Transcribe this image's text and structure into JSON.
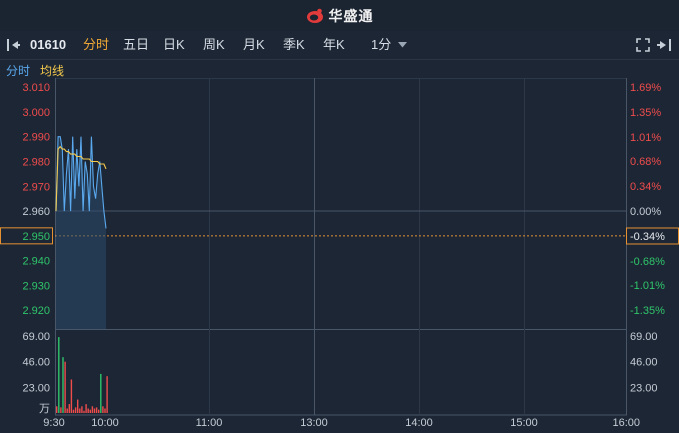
{
  "app": {
    "brand": "华盛通"
  },
  "toolbar": {
    "stock_code": "01610",
    "tabs": [
      "分时",
      "五日",
      "日K",
      "周K",
      "月K",
      "季K",
      "年K"
    ],
    "active_tab": "分时",
    "interval": "1分"
  },
  "subbar": {
    "mode_label": "分时",
    "ma_label": "均线"
  },
  "chart_data": {
    "type": "line",
    "price_axis": {
      "ticks": [
        "3.010",
        "3.000",
        "2.990",
        "2.980",
        "2.970",
        "2.960",
        "2.950",
        "2.940",
        "2.930",
        "2.920"
      ],
      "prev_close": 2.96,
      "current": 2.95
    },
    "pct_axis": {
      "ticks": [
        "1.69%",
        "1.35%",
        "1.01%",
        "0.68%",
        "0.34%",
        "0.00%",
        "-0.34%",
        "-0.68%",
        "-1.01%",
        "-1.35%"
      ]
    },
    "volume_axis": {
      "ticks": [
        "69.00",
        "46.00",
        "23.00"
      ],
      "unit": "万",
      "max": 69
    },
    "x_labels": [
      "9:30",
      "10:00",
      "11:00",
      "13:00",
      "14:00",
      "15:00",
      "16:00"
    ],
    "series": [
      {
        "values": [
          2.96,
          2.99,
          2.99,
          2.985,
          2.96,
          2.975,
          2.985,
          2.96,
          2.99,
          2.965,
          2.985,
          2.97,
          2.99,
          2.96,
          2.98,
          2.975,
          2.96,
          2.99,
          2.97,
          2.965,
          2.975,
          2.98,
          2.97,
          2.96,
          2.953
        ]
      },
      {
        "values": [
          2.96,
          2.985,
          2.986,
          2.985,
          2.985,
          2.984,
          2.984,
          2.983,
          2.983,
          2.983,
          2.982,
          2.982,
          2.982,
          2.981,
          2.981,
          2.981,
          2.981,
          2.98,
          2.98,
          2.98,
          2.98,
          2.979,
          2.979,
          2.979,
          2.977
        ]
      }
    ],
    "volume": [
      {
        "v": 6,
        "up": true
      },
      {
        "v": 68,
        "up": false
      },
      {
        "v": 5,
        "up": true
      },
      {
        "v": 50,
        "up": false
      },
      {
        "v": 46,
        "up": true
      },
      {
        "v": 4,
        "up": false
      },
      {
        "v": 8,
        "up": false
      },
      {
        "v": 30,
        "up": true
      },
      {
        "v": 3,
        "up": false
      },
      {
        "v": 5,
        "up": false
      },
      {
        "v": 12,
        "up": true
      },
      {
        "v": 4,
        "up": false
      },
      {
        "v": 6,
        "up": false
      },
      {
        "v": 2,
        "up": false
      },
      {
        "v": 8,
        "up": true
      },
      {
        "v": 4,
        "up": false
      },
      {
        "v": 3,
        "up": false
      },
      {
        "v": 6,
        "up": false
      },
      {
        "v": 4,
        "up": true
      },
      {
        "v": 5,
        "up": false
      },
      {
        "v": 3,
        "up": false
      },
      {
        "v": 35,
        "up": false
      },
      {
        "v": 6,
        "up": true
      },
      {
        "v": 4,
        "up": false
      },
      {
        "v": 33,
        "up": true
      }
    ]
  },
  "colors": {
    "price_line": "#5aa9ef",
    "avg_line": "#f4c94c",
    "up": "#ef4c4c",
    "down": "#2fc56b",
    "neutral": "#c4ccd6",
    "accent": "#f0a935",
    "grid": "#2c3747",
    "baseline": "#485668",
    "current_line": "#e59132"
  }
}
